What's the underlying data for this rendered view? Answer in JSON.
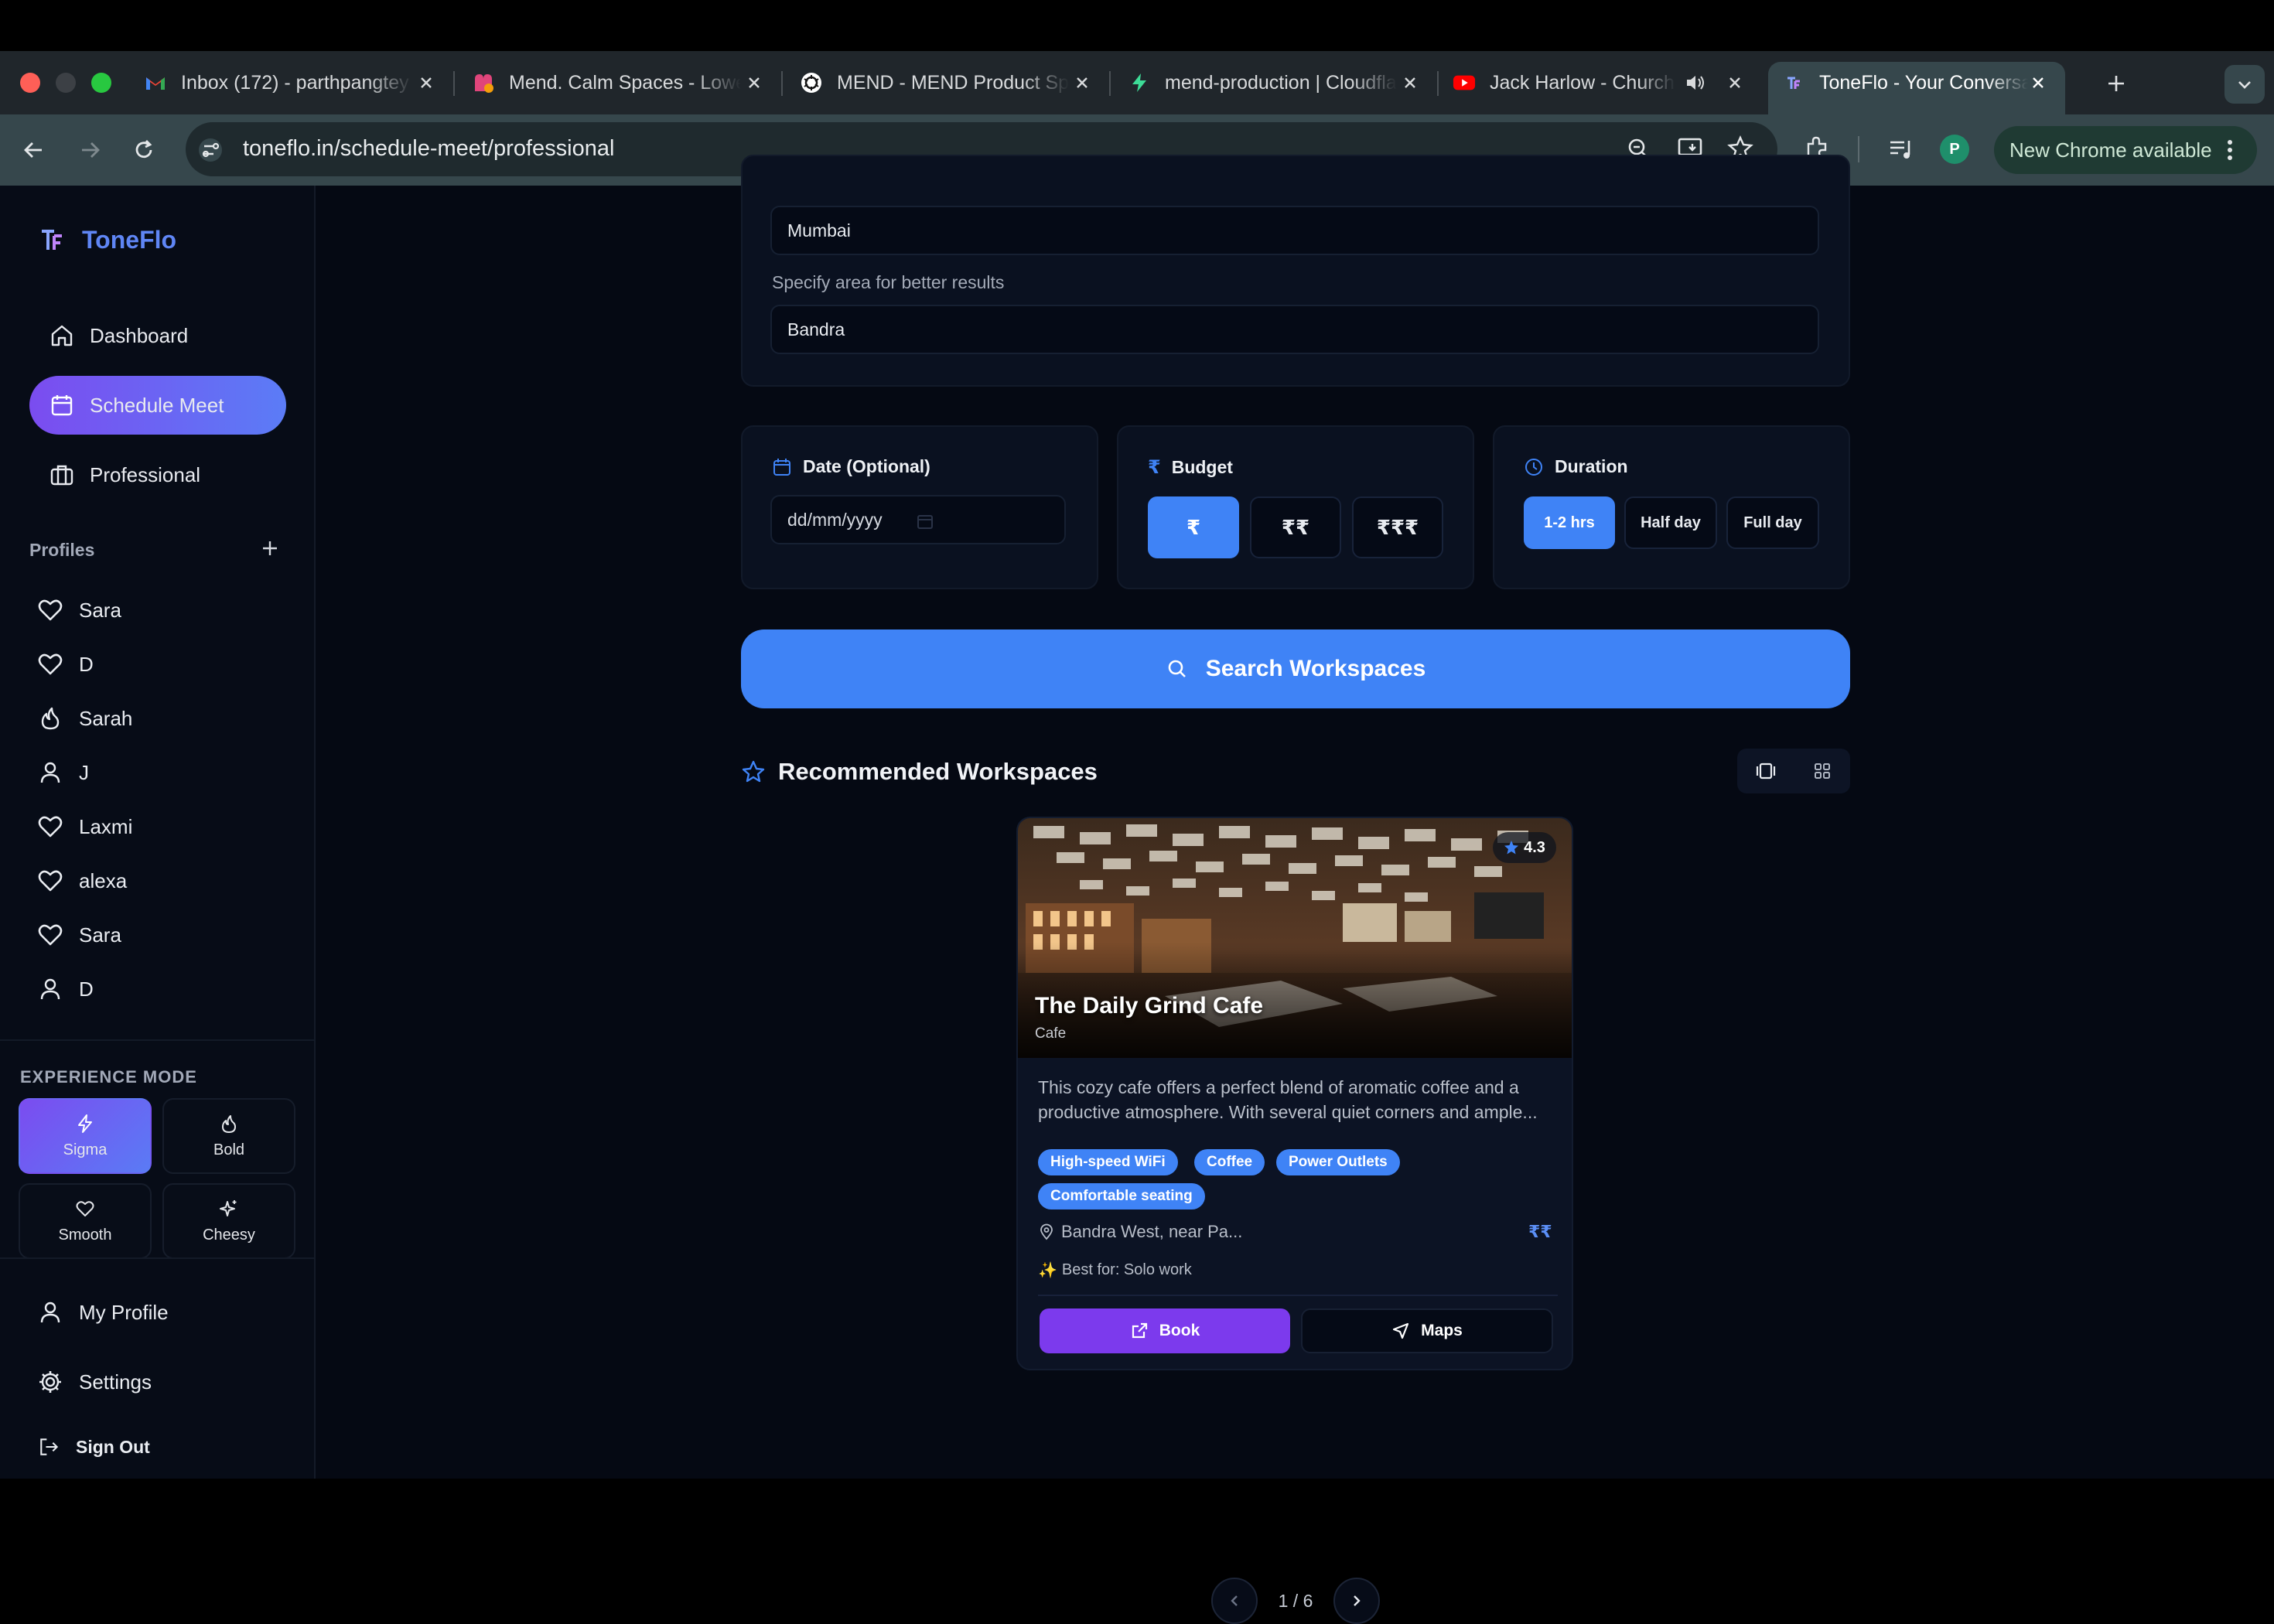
{
  "browser": {
    "tabs": [
      {
        "title": "Inbox (172) - parthpangtey"
      },
      {
        "title": "Mend. Calm Spaces - Lower"
      },
      {
        "title": "MEND - MEND Product Specs"
      },
      {
        "title": "mend-production | Cloudflare"
      },
      {
        "title": "Jack Harlow - Church"
      },
      {
        "title": "ToneFlo - Your Conversation"
      }
    ],
    "url": "toneflo.in/schedule-meet/professional",
    "profile_initial": "P",
    "update_label": "New Chrome available"
  },
  "sidebar": {
    "brand": "ToneFlo",
    "nav": [
      {
        "label": "Dashboard"
      },
      {
        "label": "Schedule Meet"
      },
      {
        "label": "Professional"
      }
    ],
    "profiles_label": "Profiles",
    "profiles": [
      {
        "name": "Sara",
        "icon": "heart-icon"
      },
      {
        "name": "D",
        "icon": "heart-icon"
      },
      {
        "name": "Sarah",
        "icon": "flame-icon"
      },
      {
        "name": "J",
        "icon": "user-icon"
      },
      {
        "name": "Laxmi",
        "icon": "heart-icon"
      },
      {
        "name": "alexa",
        "icon": "heart-icon"
      },
      {
        "name": "Sara",
        "icon": "heart-icon"
      },
      {
        "name": "D",
        "icon": "user-icon"
      }
    ],
    "experience_label": "EXPERIENCE MODE",
    "modes": [
      {
        "label": "Sigma"
      },
      {
        "label": "Bold"
      },
      {
        "label": "Smooth"
      },
      {
        "label": "Cheesy"
      }
    ],
    "footer": {
      "my_profile": "My Profile",
      "settings": "Settings",
      "sign_out": "Sign Out"
    }
  },
  "form": {
    "city_value": "Mumbai",
    "area_hint": "Specify area for better results",
    "area_value": "Bandra",
    "date_label": "Date (Optional)",
    "date_placeholder": "dd/mm/yyyy",
    "budget_label": "Budget",
    "budget_options": [
      "₹",
      "₹₹",
      "₹₹₹"
    ],
    "duration_label": "Duration",
    "duration_options": [
      "1-2 hrs",
      "Half day",
      "Full day"
    ],
    "search_label": "Search Workspaces"
  },
  "recommended": {
    "title": "Recommended Workspaces",
    "card": {
      "rating": "4.3",
      "name": "The Daily Grind Cafe",
      "type": "Cafe",
      "description": "This cozy cafe offers a perfect blend of aromatic coffee and a productive atmosphere. With several quiet corners and ample...",
      "tags": [
        "High-speed WiFi",
        "Coffee",
        "Power Outlets",
        "Comfortable seating"
      ],
      "location": "Bandra West, near Pa...",
      "price": "₹₹",
      "best_for": "Best for: Solo work",
      "book_label": "Book",
      "maps_label": "Maps"
    },
    "pagination": "1 / 6"
  },
  "colors": {
    "accent_blue": "#3f83f6",
    "accent_purple": "#7c3aed",
    "brand_blue": "#5f86f5",
    "background": "#050913"
  }
}
